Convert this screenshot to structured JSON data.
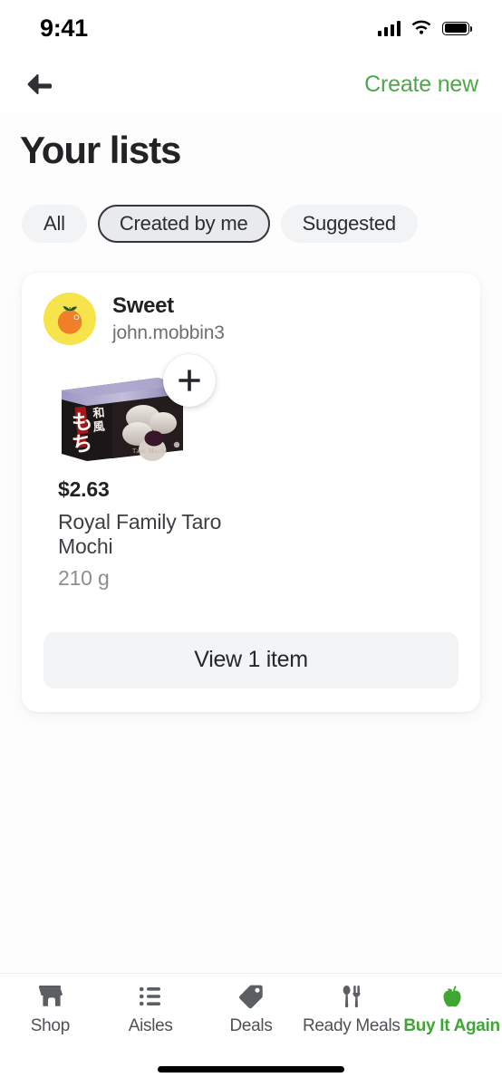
{
  "status_bar": {
    "time": "9:41",
    "signal_icon": "cellular-signal-icon",
    "wifi_icon": "wifi-icon",
    "battery_icon": "battery-full-icon"
  },
  "navbar": {
    "back_icon": "back-arrow-icon",
    "create_new_label": "Create new"
  },
  "page": {
    "title": "Your lists"
  },
  "filters": {
    "chips": [
      {
        "label": "All",
        "selected": false
      },
      {
        "label": "Created by me",
        "selected": true
      },
      {
        "label": "Suggested",
        "selected": false
      }
    ]
  },
  "list_card": {
    "avatar_icon": "orange-fruit-avatar-icon",
    "name": "Sweet",
    "owner": "john.mobbin3",
    "add_icon": "plus-icon",
    "product": {
      "image_alt": "royal-family-taro-mochi-box",
      "image_text_primary": "和風",
      "image_text_secondary": "もち",
      "image_text_latin": "Taro Mochi",
      "price": "$2.63",
      "name": "Royal Family Taro Mochi",
      "size": "210 g"
    },
    "view_button_label": "View 1 item"
  },
  "tabbar": {
    "items": [
      {
        "label": "Shop",
        "icon": "store-icon",
        "active": false
      },
      {
        "label": "Aisles",
        "icon": "list-bullets-icon",
        "active": false
      },
      {
        "label": "Deals",
        "icon": "price-tag-icon",
        "active": false
      },
      {
        "label": "Ready Meals",
        "icon": "fork-spoon-icon",
        "active": false
      },
      {
        "label": "Buy It Again",
        "icon": "green-apple-icon",
        "active": true
      }
    ]
  },
  "colors": {
    "brand_green": "#3FA535",
    "link_green": "#50A64A",
    "avatar_yellow": "#F7E34B",
    "avatar_orange": "#F07F2A",
    "chip_bg": "#F2F3F5",
    "chip_selected_border": "#343639",
    "button_bg": "#F3F4F6",
    "text_primary": "#202124",
    "text_muted": "#8B8E93"
  }
}
